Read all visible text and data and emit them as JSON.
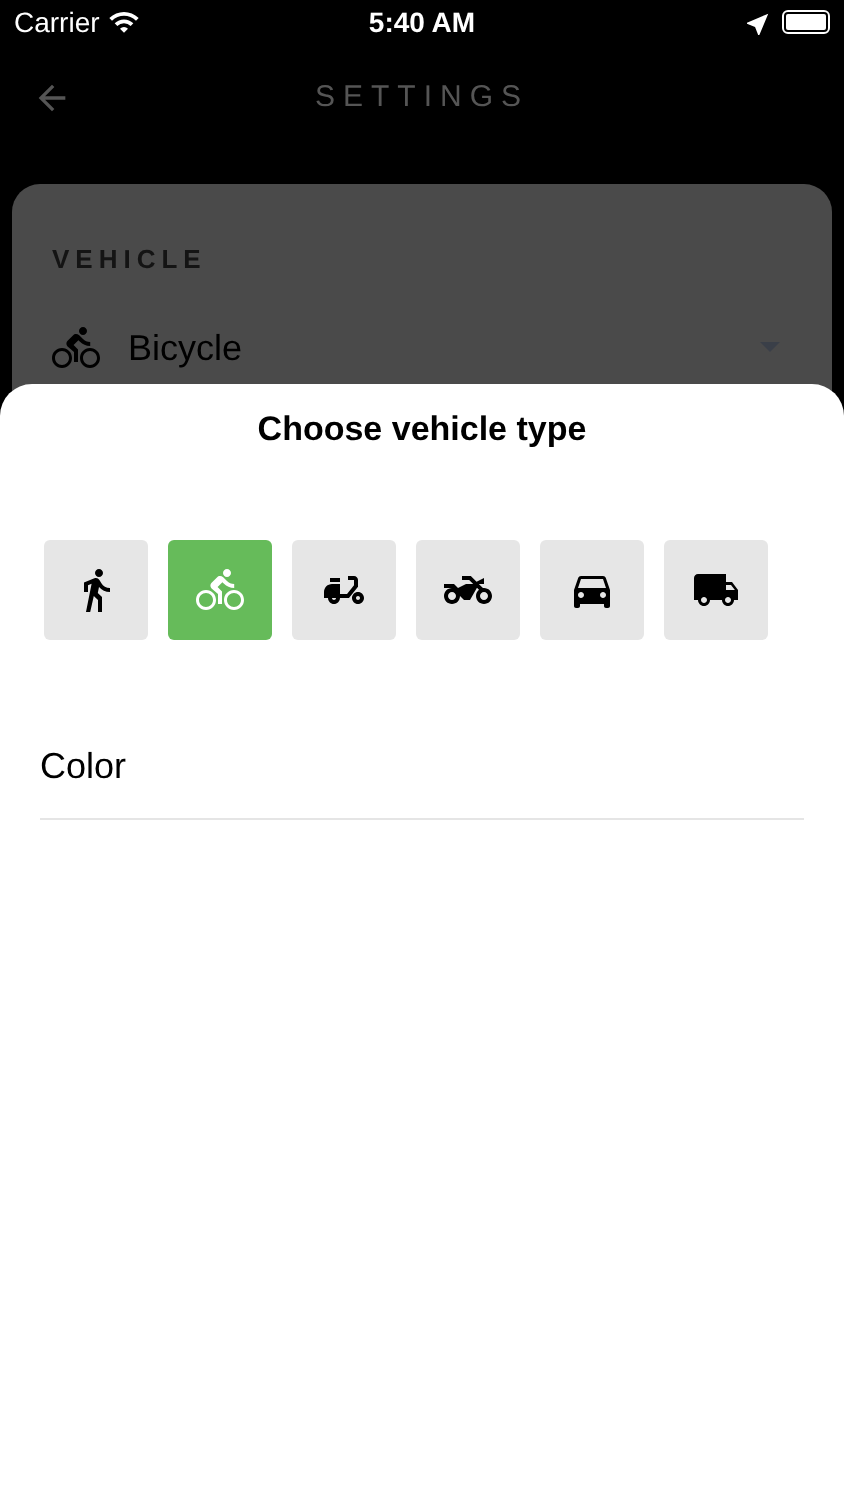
{
  "status_bar": {
    "carrier": "Carrier",
    "time": "5:40 AM"
  },
  "header": {
    "title": "SETTINGS"
  },
  "settings_card": {
    "section_title": "VEHICLE",
    "vehicle_value": "Bicycle"
  },
  "sheet": {
    "title": "Choose vehicle type",
    "vehicle_types": [
      {
        "kind": "walk",
        "selected": false
      },
      {
        "kind": "bike",
        "selected": true
      },
      {
        "kind": "scooter",
        "selected": false
      },
      {
        "kind": "motorcycle",
        "selected": false
      },
      {
        "kind": "car",
        "selected": false
      },
      {
        "kind": "truck",
        "selected": false
      }
    ],
    "color_label": "Color"
  }
}
